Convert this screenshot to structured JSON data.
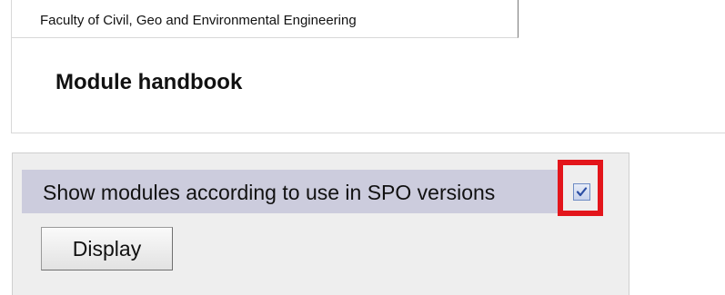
{
  "header": {
    "faculty_tab_label": "Faculty of Civil, Geo and Environmental Engineering",
    "title": "Module handbook"
  },
  "form": {
    "option_label": "Show modules according to use in SPO versions",
    "option_checked": true,
    "display_button_label": "Display"
  },
  "colors": {
    "highlight": "#e3151b",
    "option_row_bg": "#ccccdd",
    "panel_bg": "#eeeeee"
  },
  "icons": {
    "checkbox": "checkmark-icon"
  }
}
